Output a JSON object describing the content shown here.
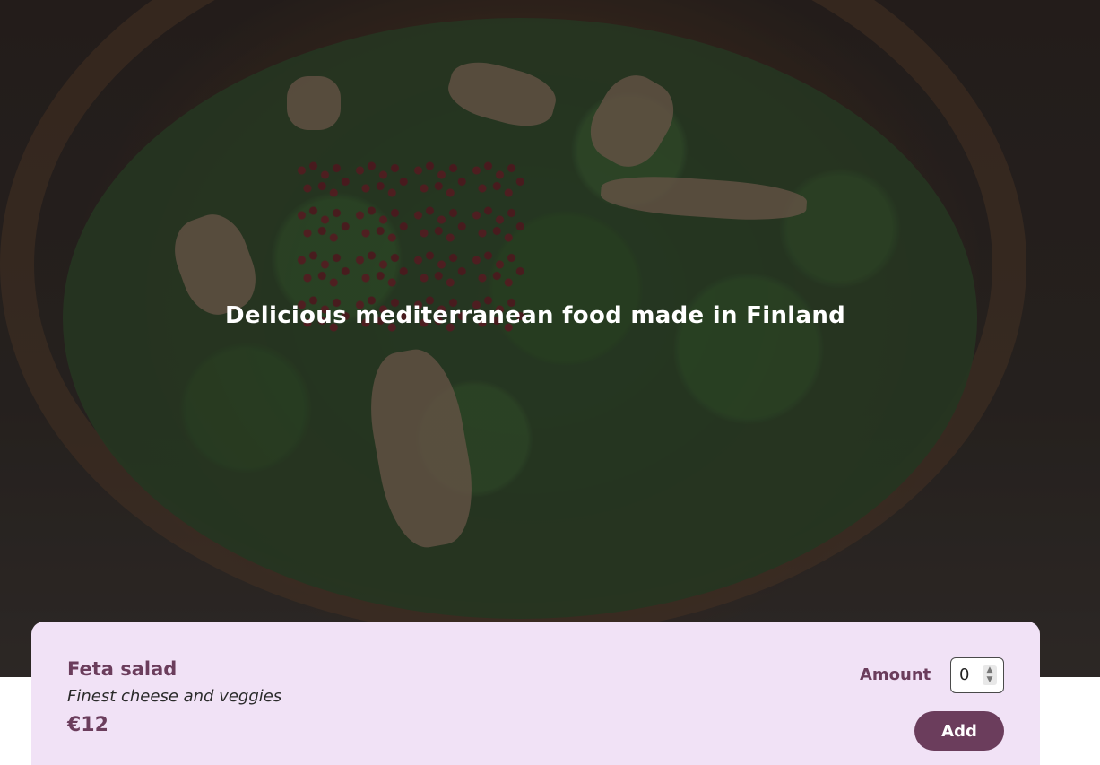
{
  "hero": {
    "tagline": "Delicious mediterranean food made in Finland",
    "image": "salad-bowl-photo"
  },
  "meal": {
    "name": "Feta salad",
    "description": "Finest cheese and veggies",
    "price": "€12",
    "amount_label": "Amount",
    "amount_value": "0",
    "add_label": "Add"
  },
  "colors": {
    "accent": "#6b3d5c",
    "card_background": "#f1e2f6",
    "tagline": "#ffffff"
  }
}
